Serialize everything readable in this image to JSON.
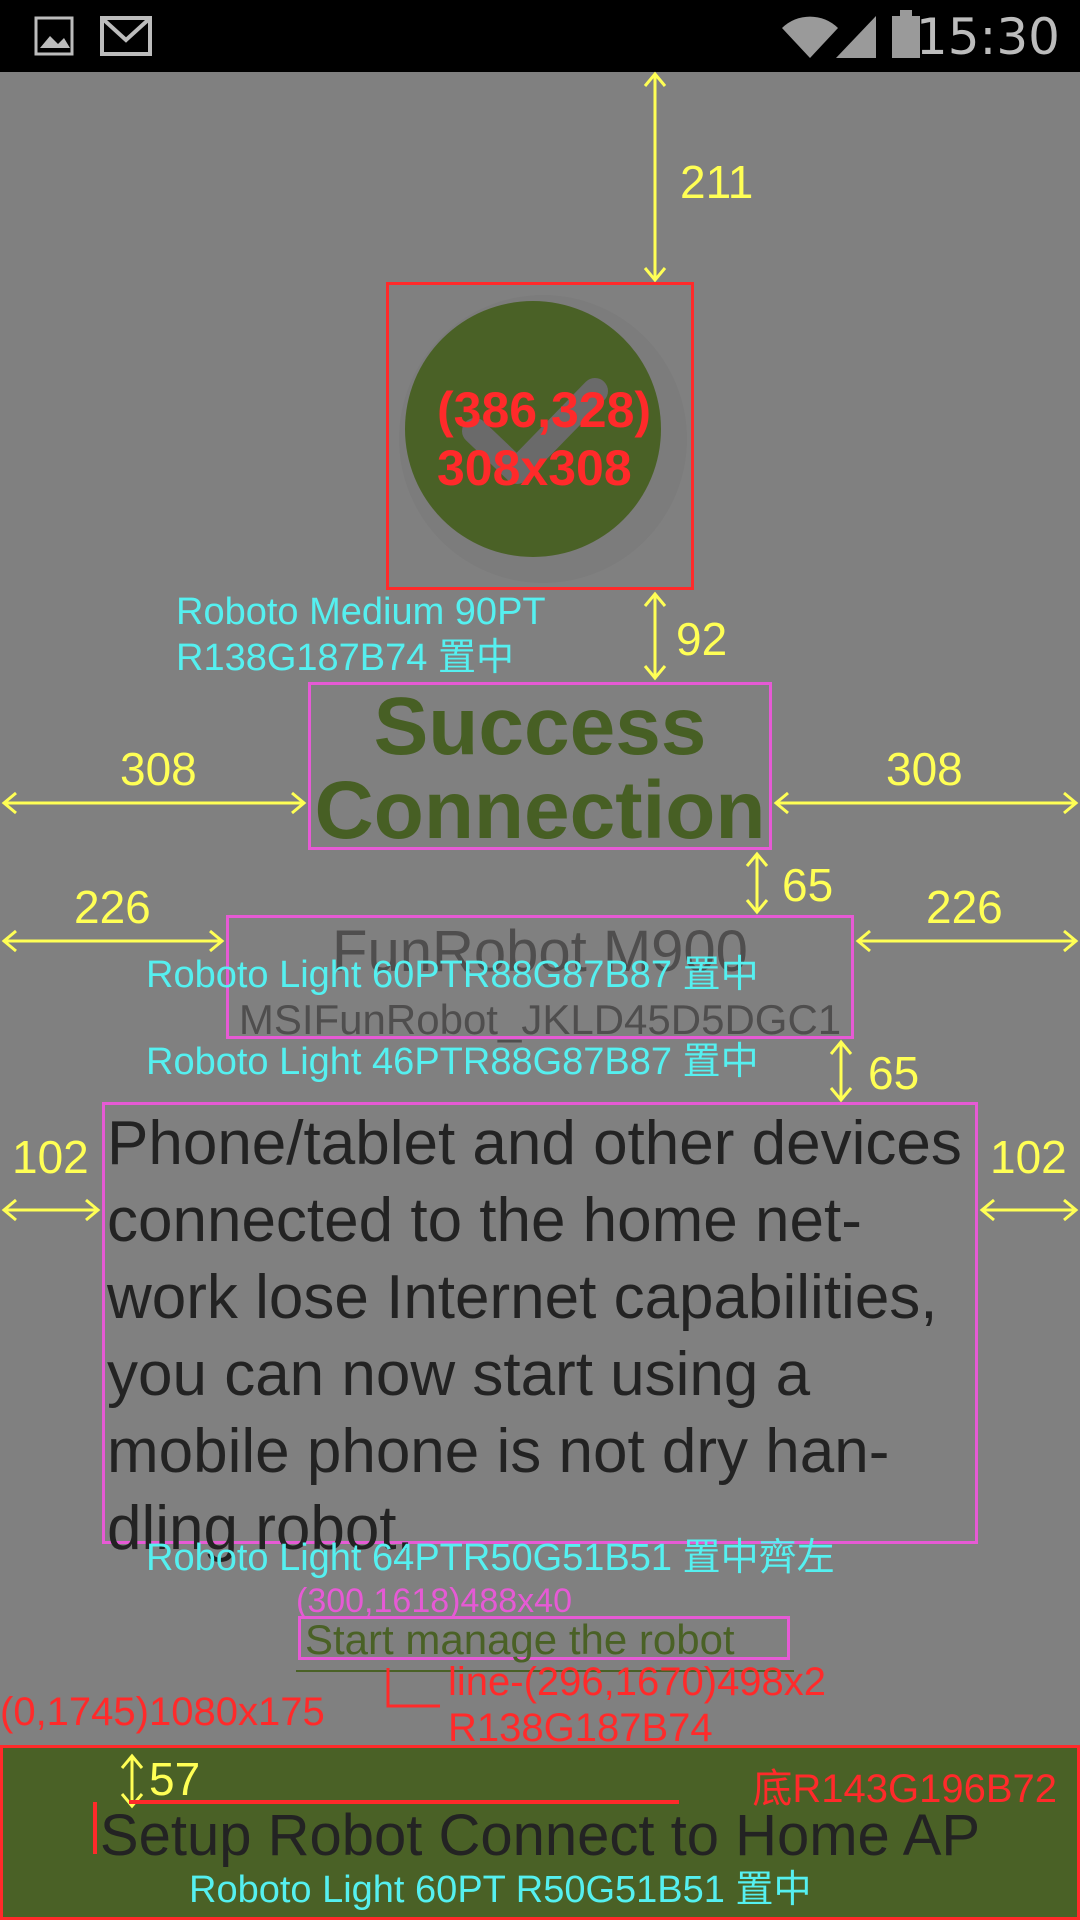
{
  "status_bar": {
    "time": "15:30",
    "icons": [
      "image-icon",
      "gmail-icon",
      "wifi-icon",
      "signal-icon",
      "battery-icon"
    ]
  },
  "success": {
    "title_line1": "Success",
    "title_line2": "Connection"
  },
  "device": {
    "name": "FunRobot M900",
    "ssid": "MSIFunRobot_JKLD45D5DGC1"
  },
  "body_text": "Phone/tablet and other devices connected to the home net-work lose Internet capabilities, you can now start using a mobile phone is not dry han-dling robot.",
  "manage_link": "Start manage the robot",
  "bottom_button": "Setup Robot Connect to Home AP",
  "annotations": {
    "dim_211": "211",
    "icon_pos": "(386,328)",
    "icon_size": "308x308",
    "title_font_1": "Roboto Medium 90PT",
    "title_font_2": "R138G187B74 置中",
    "dim_92": "92",
    "dim_308_left": "308",
    "dim_308_right": "308",
    "dim_65_a": "65",
    "dim_226_left": "226",
    "dim_226_right": "226",
    "device_font": "Roboto Light 60PTR88G87B87 置中",
    "ssid_font": "Roboto Light 46PTR88G87B87 置中",
    "dim_65_b": "65",
    "dim_102_left": "102",
    "dim_102_right": "102",
    "body_font": "Roboto Light 64PTR50G51B51 置中齊左",
    "link_pos": "(300,1618)488x40",
    "line_spec_1": "line-(296,1670)498x2",
    "line_spec_2": "R138G187B74",
    "bar_spec": "(0,1745)1080x175",
    "bar_color": "底R143G196B72",
    "dim_57": "57",
    "bottom_font": "Roboto Light 60PT R50G51B51 置中"
  },
  "colors": {
    "background": "#808080",
    "accent_green": "#4a6126",
    "text_dark": "#232323",
    "annotation_cyan": "#55f0f0",
    "annotation_yellow": "#ffff55",
    "annotation_red": "#ff2a2a",
    "annotation_magenta": "#e65ad5"
  }
}
